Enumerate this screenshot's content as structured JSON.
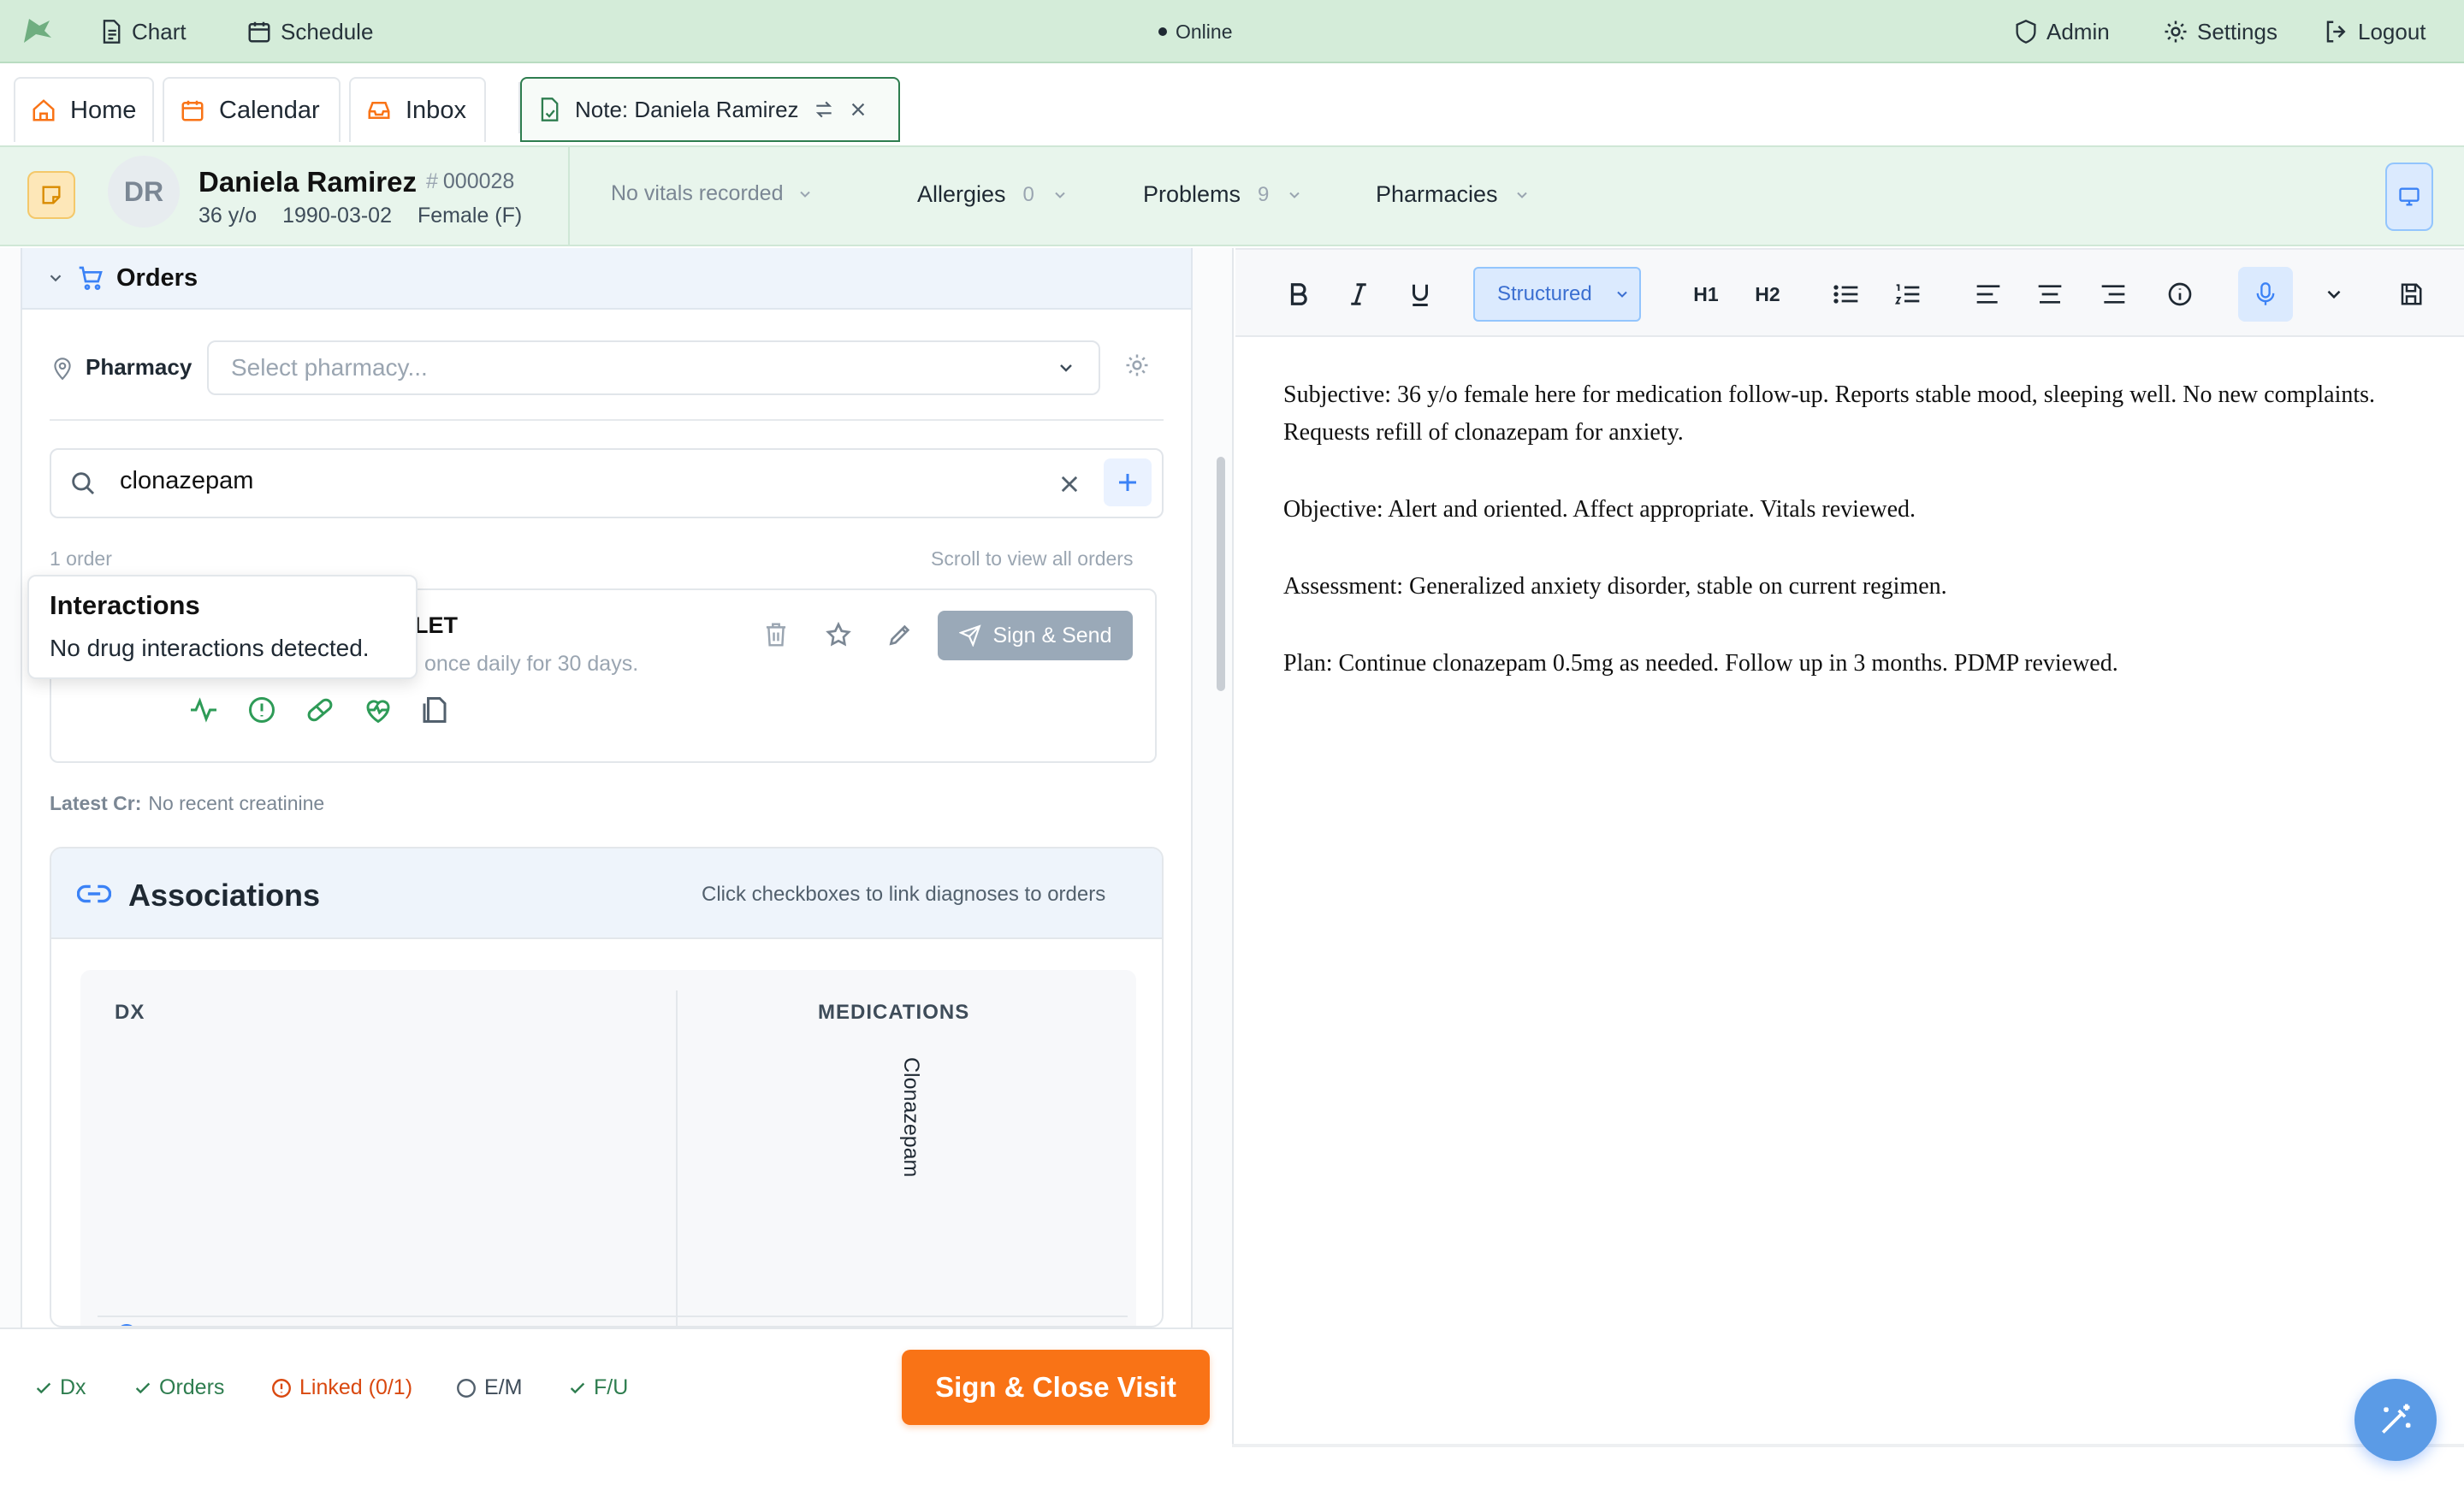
{
  "topbar": {
    "nav": [
      {
        "label": "Chart",
        "icon": "document-icon"
      },
      {
        "label": "Schedule",
        "icon": "calendar-icon"
      }
    ],
    "status": "Online",
    "right": [
      {
        "label": "Admin",
        "icon": "shield-icon"
      },
      {
        "label": "Settings",
        "icon": "gear-icon"
      },
      {
        "label": "Logout",
        "icon": "logout-icon"
      }
    ]
  },
  "tabs": [
    {
      "label": "Home"
    },
    {
      "label": "Calendar"
    },
    {
      "label": "Inbox"
    },
    {
      "label": "Note: Daniela Ramirez",
      "active": true
    }
  ],
  "patient": {
    "initials": "DR",
    "name": "Daniela Ramirez",
    "mrn": "000028",
    "age": "36 y/o",
    "dob": "1990-03-02",
    "sex": "Female (F)",
    "vitals": "No vitals recorded",
    "allergies_label": "Allergies",
    "allergies_count": "0",
    "problems_label": "Problems",
    "problems_count": "9",
    "pharmacies_label": "Pharmacies"
  },
  "orders": {
    "title": "Orders",
    "pharmacy_label": "Pharmacy",
    "pharmacy_placeholder": "Select pharmacy...",
    "search_value": "clonazepam",
    "order_count": "1 order",
    "scroll_hint": "Scroll to view all orders",
    "item": {
      "name_tail": "LET",
      "sig_tail": "once daily for 30 days.",
      "sign_send": "Sign & Send"
    },
    "tooltip": {
      "title": "Interactions",
      "body": "No drug interactions detected."
    },
    "latest_cr_label": "Latest Cr:",
    "latest_cr_value": "No recent creatinine"
  },
  "associations": {
    "title": "Associations",
    "hint": "Click checkboxes to link diagnoses to orders",
    "col_dx": "DX",
    "col_meds": "MEDICATIONS",
    "med_name": "Clonazepam"
  },
  "footer": {
    "checks": [
      {
        "label": "Dx",
        "state": "done",
        "color": "#2e7d4f"
      },
      {
        "label": "Orders",
        "state": "done",
        "color": "#2e7d4f"
      },
      {
        "label": "Linked (0/1)",
        "state": "warn",
        "color": "#d9480f"
      },
      {
        "label": "E/M",
        "state": "empty",
        "color": "#52606d"
      },
      {
        "label": "F/U",
        "state": "done",
        "color": "#2e7d4f"
      }
    ],
    "sign_close": "Sign & Close Visit"
  },
  "editor": {
    "format_select": "Structured",
    "h1": "H1",
    "h2": "H2",
    "paragraphs": [
      "Subjective: 36 y/o female here for medication follow-up. Reports stable mood, sleeping well. No new complaints. Requests refill of clonazepam for anxiety.",
      "Objective: Alert and oriented. Affect appropriate. Vitals reviewed.",
      "Assessment: Generalized anxiety disorder, stable on current regimen.",
      "Plan: Continue clonazepam 0.5mg as needed. Follow up in 3 months. PDMP reviewed."
    ]
  },
  "colors": {
    "brand_green": "#2e7d4f",
    "accent_orange": "#f97316",
    "accent_blue": "#3b82f6"
  }
}
